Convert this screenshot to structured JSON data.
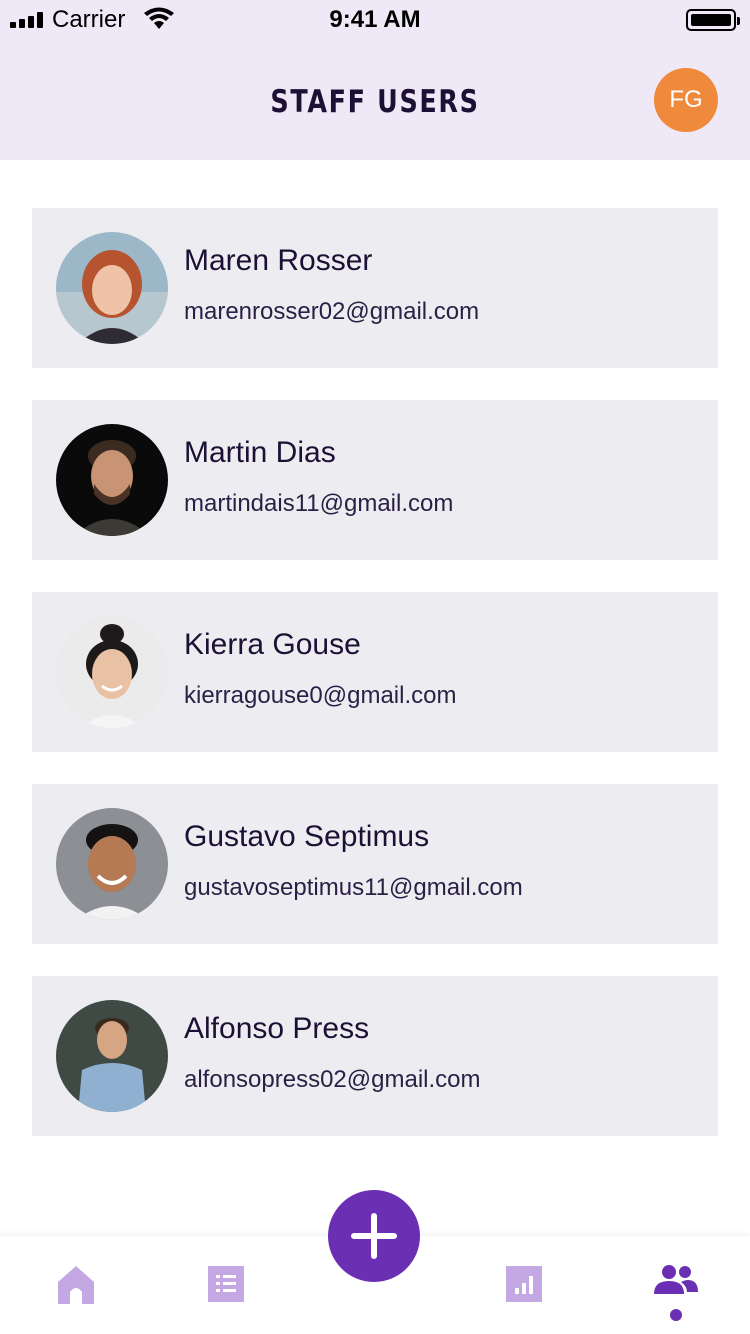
{
  "status_bar": {
    "carrier": "Carrier",
    "time": "9:41 AM"
  },
  "header": {
    "title": "STAFF USERS",
    "user_initials": "FG",
    "avatar_color": "#ef8a3d"
  },
  "users": [
    {
      "name": "Maren Rosser",
      "email": "marenrosser02@gmail.com"
    },
    {
      "name": "Martin Dias",
      "email": "martindais11@gmail.com"
    },
    {
      "name": "Kierra Gouse",
      "email": "kierragouse0@gmail.com"
    },
    {
      "name": "Gustavo Septimus",
      "email": "gustavoseptimus11@gmail.com"
    },
    {
      "name": "Alfonso Press",
      "email": "alfonsopress02@gmail.com"
    }
  ],
  "tab_bar": {
    "items": [
      "home-icon",
      "list-icon",
      "add-icon",
      "chart-icon",
      "users-icon"
    ],
    "active": "users-icon",
    "accent_color": "#6a2fb2",
    "inactive_color": "#c4a8e4"
  },
  "colors": {
    "header_bg": "#efe8f6",
    "card_bg": "#ededf1",
    "text_primary": "#1c1034"
  }
}
